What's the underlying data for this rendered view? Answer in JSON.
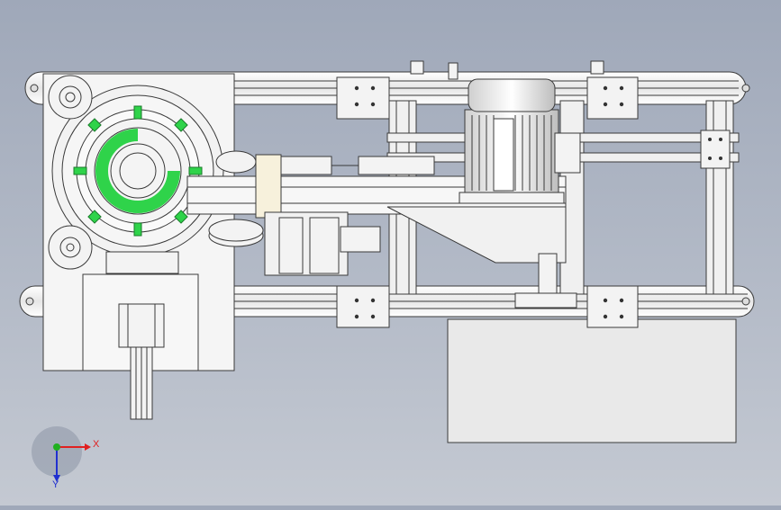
{
  "viewport": {
    "background_top": "#9fa8b9",
    "background_bottom": "#c4c9d2"
  },
  "triad": {
    "x_label": "X",
    "y_label": "Y",
    "x_color": "#e02020",
    "y_color": "#2030d0",
    "z_color": "#20b020"
  },
  "colors": {
    "part_fill": "#f2f2f2",
    "part_stroke": "#3a3a3a",
    "accent_green": "#2fd34a",
    "motor_body": "#e8e8e8"
  }
}
